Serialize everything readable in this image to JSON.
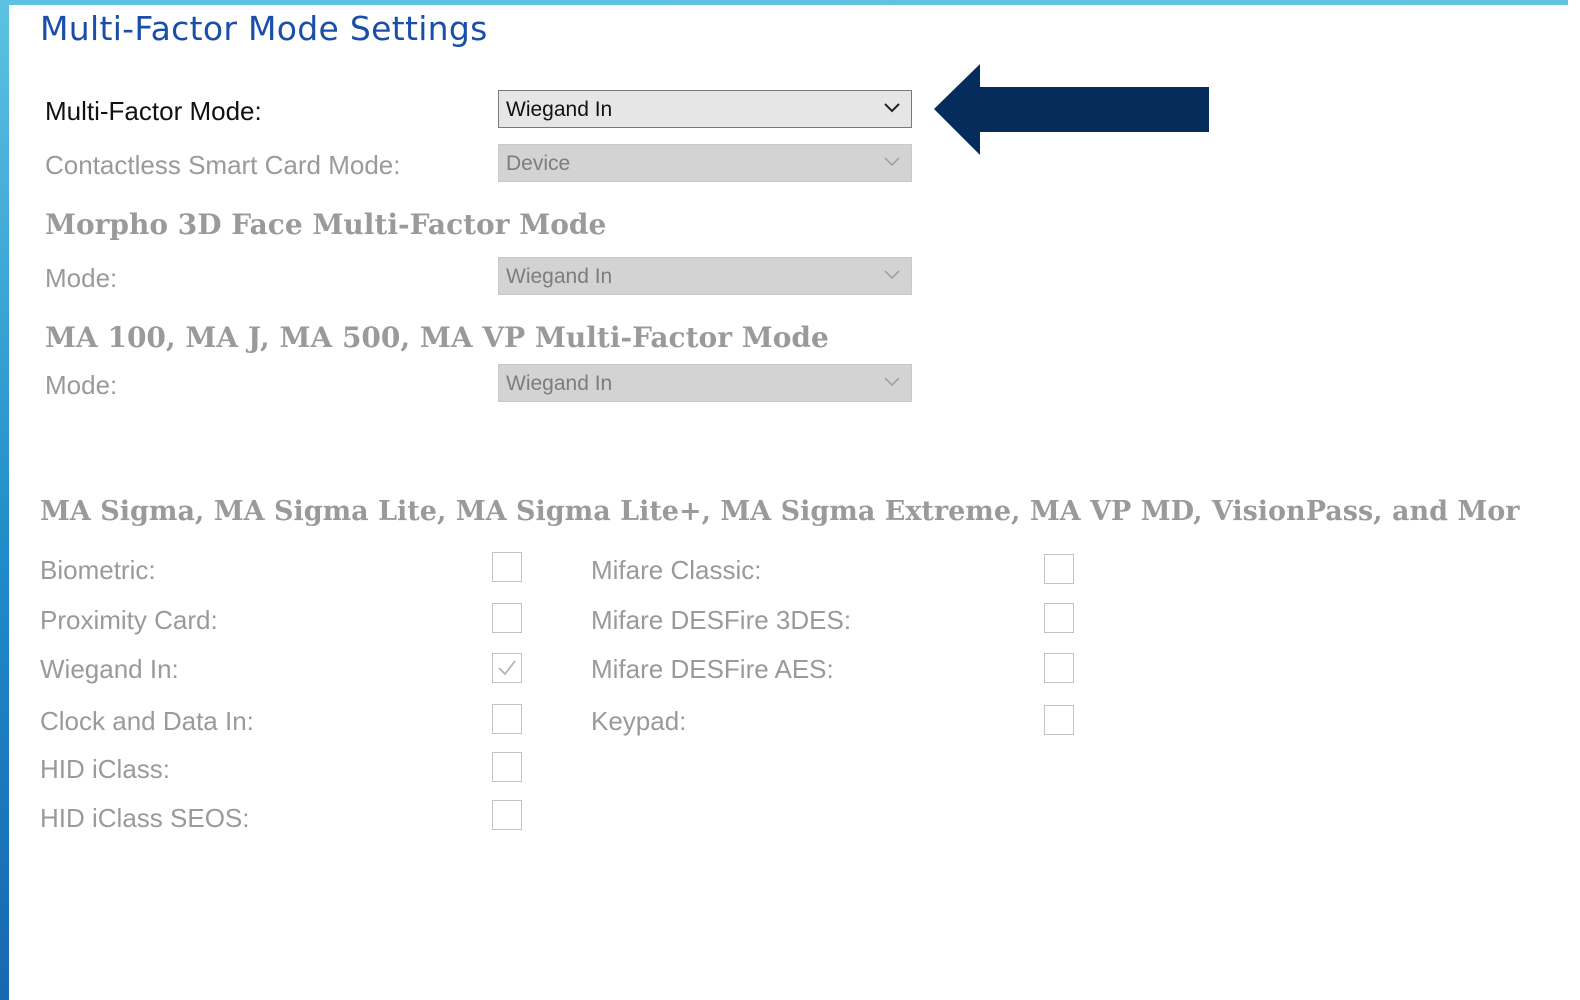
{
  "title": "Multi-Factor Mode Settings",
  "multi_factor": {
    "label": "Multi-Factor Mode:",
    "value": "Wiegand In"
  },
  "contactless": {
    "label": "Contactless Smart Card Mode:",
    "value": "Device"
  },
  "morpho_3d": {
    "heading": "Morpho 3D Face Multi-Factor Mode",
    "mode_label": "Mode:",
    "value": "Wiegand In"
  },
  "ma_series": {
    "heading": "MA 100, MA J, MA 500, MA VP Multi-Factor Mode",
    "mode_label": "Mode:",
    "value": "Wiegand In"
  },
  "sigma": {
    "heading": "MA Sigma, MA Sigma Lite, MA Sigma Lite+, MA Sigma Extreme, MA VP MD, VisionPass, and Mor",
    "left_options": [
      {
        "label": "Biometric:",
        "checked": false
      },
      {
        "label": "Proximity Card:",
        "checked": false
      },
      {
        "label": "Wiegand In:",
        "checked": true
      },
      {
        "label": "Clock and Data In:",
        "checked": false
      },
      {
        "label": "HID iClass:",
        "checked": false
      },
      {
        "label": "HID iClass SEOS:",
        "checked": false
      }
    ],
    "right_options": [
      {
        "label": "Mifare Classic:",
        "checked": false
      },
      {
        "label": "Mifare DESFire 3DES:",
        "checked": false
      },
      {
        "label": "Mifare DESFire AES:",
        "checked": false
      },
      {
        "label": "Keypad:",
        "checked": false
      }
    ]
  },
  "colors": {
    "title": "#1b4ea8",
    "arrow": "#052c5a",
    "disabled_text": "#9a9a9a",
    "left_bar": "#1f8cc8"
  },
  "icons": {
    "dropdown": "chevron-down-icon",
    "callout": "arrow-left-icon",
    "check": "checkmark-icon"
  }
}
